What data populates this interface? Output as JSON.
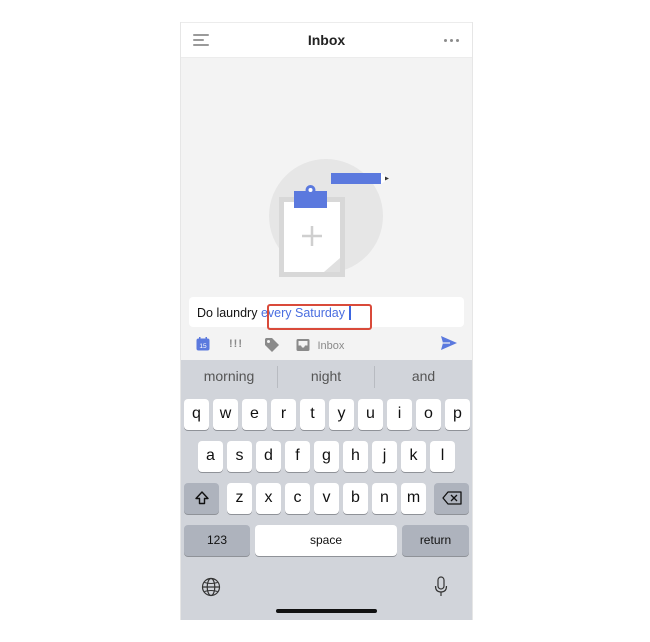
{
  "header": {
    "title": "Inbox",
    "menu_icon": "menu-icon",
    "more_icon": "more-horizontal-icon"
  },
  "empty_state": {
    "illustration": "clipboard-with-pencil-and-plus"
  },
  "task_input": {
    "text_plain": "Do laundry",
    "text_highlight": "every Saturday",
    "highlight_color": "#4a6ee0",
    "annotation_color": "#d94a3a"
  },
  "toolbar": {
    "date_badge": "15",
    "priority_label": "!!!",
    "tag_icon": "tag-icon",
    "list_label": "Inbox",
    "send_icon": "send-icon",
    "accent": "#4a6ee0"
  },
  "keyboard": {
    "suggestions": [
      "morning",
      "night",
      "and"
    ],
    "row1": [
      "q",
      "w",
      "e",
      "r",
      "t",
      "y",
      "u",
      "i",
      "o",
      "p"
    ],
    "row2": [
      "a",
      "s",
      "d",
      "f",
      "g",
      "h",
      "j",
      "k",
      "l"
    ],
    "row3": [
      "z",
      "x",
      "c",
      "v",
      "b",
      "n",
      "m"
    ],
    "numbers_label": "123",
    "space_label": "space",
    "return_label": "return"
  }
}
